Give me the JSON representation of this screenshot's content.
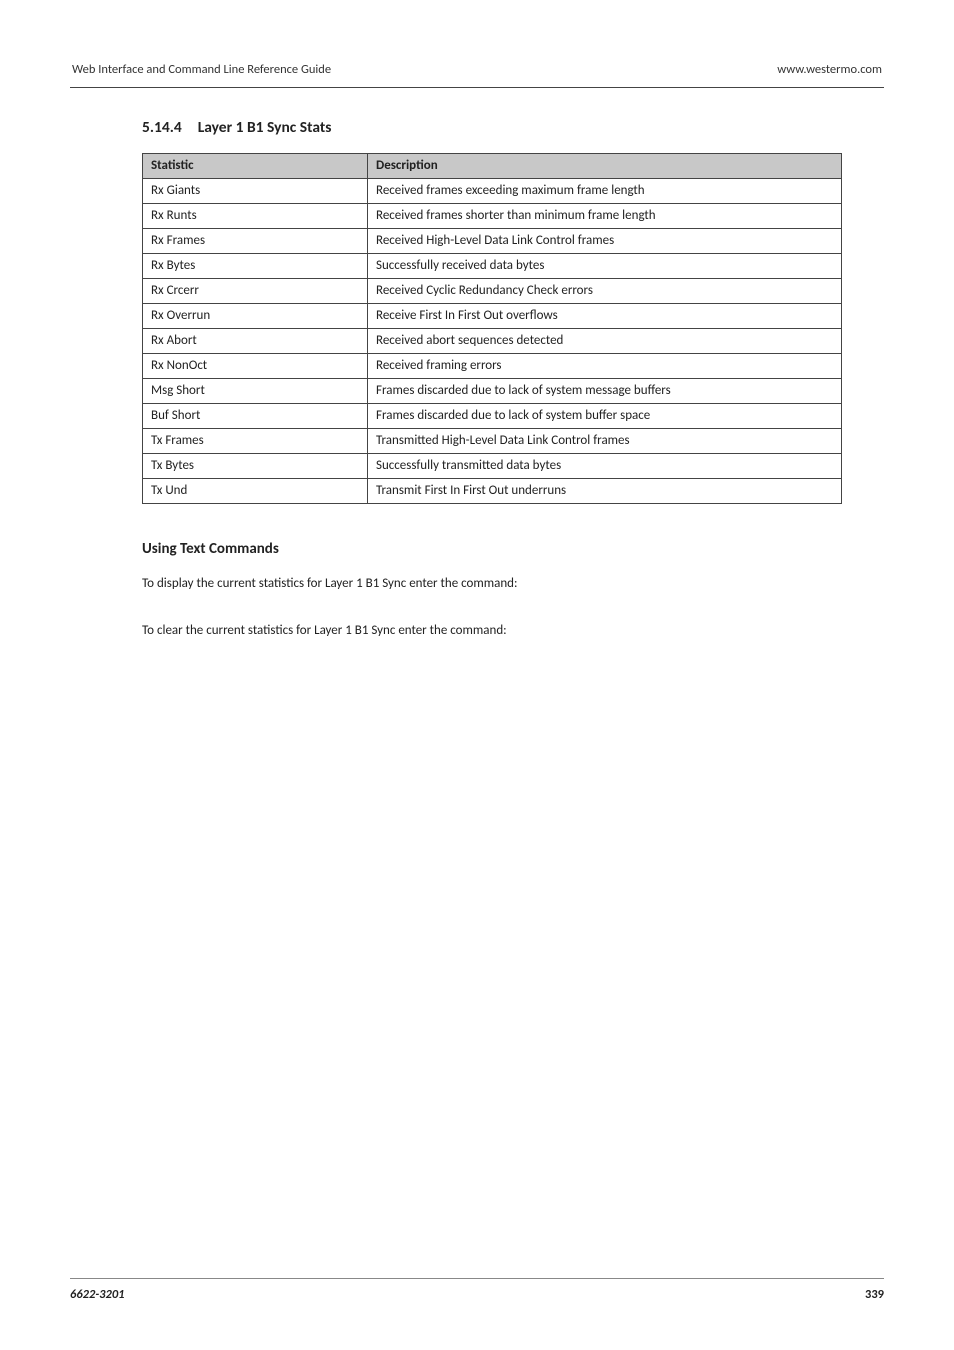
{
  "header": {
    "left": "Web Interface and Command Line Reference Guide",
    "right": "www.westermo.com"
  },
  "section": {
    "number": "5.14.4",
    "title": "Layer 1 B1 Sync Stats"
  },
  "table": {
    "headers": {
      "stat": "Statistic",
      "desc": "Description"
    },
    "rows": [
      {
        "stat": "Rx Giants",
        "desc": "Received frames exceeding maximum frame length"
      },
      {
        "stat": "Rx Runts",
        "desc": "Received frames shorter than minimum frame length"
      },
      {
        "stat": "Rx Frames",
        "desc": "Received High-Level Data Link Control frames"
      },
      {
        "stat": "Rx Bytes",
        "desc": "Successfully received data bytes"
      },
      {
        "stat": "Rx Crcerr",
        "desc": "Received Cyclic Redundancy Check errors"
      },
      {
        "stat": "Rx Overrun",
        "desc": "Receive First In First Out overflows"
      },
      {
        "stat": "Rx Abort",
        "desc": "Received abort sequences detected"
      },
      {
        "stat": "Rx NonOct",
        "desc": "Received framing errors"
      },
      {
        "stat": "Msg Short",
        "desc": "Frames discarded due to lack of system message buffers"
      },
      {
        "stat": "Buf Short",
        "desc": "Frames discarded due to lack of system buffer space"
      },
      {
        "stat": "Tx Frames",
        "desc": "Transmitted High-Level Data Link Control frames"
      },
      {
        "stat": "Tx Bytes",
        "desc": "Successfully transmitted data bytes"
      },
      {
        "stat": "Tx Und",
        "desc": "Transmit First In First Out underruns"
      }
    ]
  },
  "subsection": {
    "title": "Using Text Commands",
    "para1": "To display the current statistics for Layer 1 B1 Sync enter the command:",
    "para2": "To clear the current statistics for Layer 1 B1 Sync enter the command:"
  },
  "footer": {
    "left": "6622-3201",
    "right": "339"
  }
}
